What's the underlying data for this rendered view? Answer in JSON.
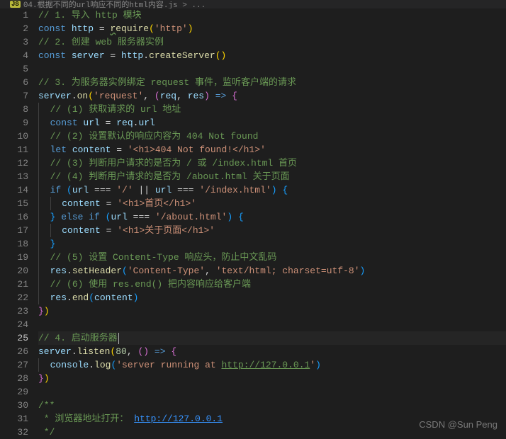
{
  "tab": {
    "badge": "JS",
    "title": "04.根据不同的url响应不同的html内容.js > ..."
  },
  "active_line": 25,
  "lines": [
    {
      "n": 1,
      "spans": [
        {
          "t": "// 1. 导入 http 模块",
          "c": "c-comment"
        }
      ]
    },
    {
      "n": 2,
      "spans": [
        {
          "t": "const ",
          "c": "c-keyword"
        },
        {
          "t": "http",
          "c": "c-var"
        },
        {
          "t": " = ",
          "c": "c-punct"
        },
        {
          "t": "r",
          "c": "c-func squiggle"
        },
        {
          "t": "equire",
          "c": "c-func"
        },
        {
          "t": "(",
          "c": "c-brace-y"
        },
        {
          "t": "'http'",
          "c": "c-string"
        },
        {
          "t": ")",
          "c": "c-brace-y"
        }
      ]
    },
    {
      "n": 3,
      "spans": [
        {
          "t": "// 2. 创建 web 服务器实例",
          "c": "c-comment"
        }
      ]
    },
    {
      "n": 4,
      "spans": [
        {
          "t": "const ",
          "c": "c-keyword"
        },
        {
          "t": "server",
          "c": "c-var"
        },
        {
          "t": " = ",
          "c": "c-punct"
        },
        {
          "t": "http",
          "c": "c-var"
        },
        {
          "t": ".",
          "c": "c-punct"
        },
        {
          "t": "createServer",
          "c": "c-func"
        },
        {
          "t": "(",
          "c": "c-brace-y"
        },
        {
          "t": ")",
          "c": "c-brace-y"
        }
      ]
    },
    {
      "n": 5,
      "spans": []
    },
    {
      "n": 6,
      "spans": [
        {
          "t": "// 3. 为服务器实例绑定 request 事件，监听客户端的请求",
          "c": "c-comment"
        }
      ]
    },
    {
      "n": 7,
      "spans": [
        {
          "t": "server",
          "c": "c-var"
        },
        {
          "t": ".",
          "c": "c-punct"
        },
        {
          "t": "on",
          "c": "c-func"
        },
        {
          "t": "(",
          "c": "c-brace-y"
        },
        {
          "t": "'request'",
          "c": "c-string"
        },
        {
          "t": ", ",
          "c": "c-punct"
        },
        {
          "t": "(",
          "c": "c-brace-p"
        },
        {
          "t": "req",
          "c": "c-var"
        },
        {
          "t": ", ",
          "c": "c-punct"
        },
        {
          "t": "res",
          "c": "c-var"
        },
        {
          "t": ")",
          "c": "c-brace-p"
        },
        {
          "t": " ",
          "c": "c-punct"
        },
        {
          "t": "=>",
          "c": "c-keyword"
        },
        {
          "t": " ",
          "c": "c-punct"
        },
        {
          "t": "{",
          "c": "c-brace-p"
        }
      ]
    },
    {
      "n": 8,
      "indent": 1,
      "spans": [
        {
          "t": "// (1) 获取请求的 url 地址",
          "c": "c-comment"
        }
      ]
    },
    {
      "n": 9,
      "indent": 1,
      "spans": [
        {
          "t": "const ",
          "c": "c-keyword"
        },
        {
          "t": "url",
          "c": "c-var"
        },
        {
          "t": " = ",
          "c": "c-punct"
        },
        {
          "t": "req",
          "c": "c-var"
        },
        {
          "t": ".",
          "c": "c-punct"
        },
        {
          "t": "url",
          "c": "c-var"
        }
      ]
    },
    {
      "n": 10,
      "indent": 1,
      "spans": [
        {
          "t": "// (2) 设置默认的响应内容为 404 Not found",
          "c": "c-comment"
        }
      ]
    },
    {
      "n": 11,
      "indent": 1,
      "spans": [
        {
          "t": "let ",
          "c": "c-keyword"
        },
        {
          "t": "content",
          "c": "c-var"
        },
        {
          "t": " = ",
          "c": "c-punct"
        },
        {
          "t": "'<h1>404 Not found!</h1>'",
          "c": "c-string"
        }
      ]
    },
    {
      "n": 12,
      "indent": 1,
      "spans": [
        {
          "t": "// (3) 判断用户请求的是否为 / 或 /index.html 首页",
          "c": "c-comment"
        }
      ]
    },
    {
      "n": 13,
      "indent": 1,
      "spans": [
        {
          "t": "// (4) 判断用户请求的是否为 /about.html 关于页面",
          "c": "c-comment"
        }
      ]
    },
    {
      "n": 14,
      "indent": 1,
      "spans": [
        {
          "t": "if ",
          "c": "c-keyword"
        },
        {
          "t": "(",
          "c": "c-brace-b"
        },
        {
          "t": "url",
          "c": "c-var"
        },
        {
          "t": " === ",
          "c": "c-punct"
        },
        {
          "t": "'/'",
          "c": "c-string"
        },
        {
          "t": " || ",
          "c": "c-punct"
        },
        {
          "t": "url",
          "c": "c-var"
        },
        {
          "t": " === ",
          "c": "c-punct"
        },
        {
          "t": "'/index.html'",
          "c": "c-string"
        },
        {
          "t": ")",
          "c": "c-brace-b"
        },
        {
          "t": " ",
          "c": "c-punct"
        },
        {
          "t": "{",
          "c": "c-brace-b"
        }
      ]
    },
    {
      "n": 15,
      "indent": 2,
      "spans": [
        {
          "t": "content",
          "c": "c-var"
        },
        {
          "t": " = ",
          "c": "c-punct"
        },
        {
          "t": "'<h1>首页</h1>'",
          "c": "c-string"
        }
      ]
    },
    {
      "n": 16,
      "indent": 1,
      "spans": [
        {
          "t": "}",
          "c": "c-brace-b"
        },
        {
          "t": " ",
          "c": "c-punct"
        },
        {
          "t": "else if ",
          "c": "c-keyword"
        },
        {
          "t": "(",
          "c": "c-brace-b"
        },
        {
          "t": "url",
          "c": "c-var"
        },
        {
          "t": " === ",
          "c": "c-punct"
        },
        {
          "t": "'/about.html'",
          "c": "c-string"
        },
        {
          "t": ")",
          "c": "c-brace-b"
        },
        {
          "t": " ",
          "c": "c-punct"
        },
        {
          "t": "{",
          "c": "c-brace-b"
        }
      ]
    },
    {
      "n": 17,
      "indent": 2,
      "spans": [
        {
          "t": "content",
          "c": "c-var"
        },
        {
          "t": " = ",
          "c": "c-punct"
        },
        {
          "t": "'<h1>关于页面</h1>'",
          "c": "c-string"
        }
      ]
    },
    {
      "n": 18,
      "indent": 1,
      "spans": [
        {
          "t": "}",
          "c": "c-brace-b"
        }
      ]
    },
    {
      "n": 19,
      "indent": 1,
      "spans": [
        {
          "t": "// (5) 设置 Content-Type 响应头，防止中文乱码",
          "c": "c-comment"
        }
      ]
    },
    {
      "n": 20,
      "indent": 1,
      "spans": [
        {
          "t": "res",
          "c": "c-var"
        },
        {
          "t": ".",
          "c": "c-punct"
        },
        {
          "t": "setHeader",
          "c": "c-func"
        },
        {
          "t": "(",
          "c": "c-brace-b"
        },
        {
          "t": "'Content-Type'",
          "c": "c-string"
        },
        {
          "t": ", ",
          "c": "c-punct"
        },
        {
          "t": "'text/html; charset=utf-8'",
          "c": "c-string"
        },
        {
          "t": ")",
          "c": "c-brace-b"
        }
      ]
    },
    {
      "n": 21,
      "indent": 1,
      "spans": [
        {
          "t": "// (6) 使用 res.end() 把内容响应给客户端",
          "c": "c-comment"
        }
      ]
    },
    {
      "n": 22,
      "indent": 1,
      "spans": [
        {
          "t": "res",
          "c": "c-var"
        },
        {
          "t": ".",
          "c": "c-punct"
        },
        {
          "t": "end",
          "c": "c-func"
        },
        {
          "t": "(",
          "c": "c-brace-b"
        },
        {
          "t": "content",
          "c": "c-var"
        },
        {
          "t": ")",
          "c": "c-brace-b"
        }
      ]
    },
    {
      "n": 23,
      "spans": [
        {
          "t": "}",
          "c": "c-brace-p"
        },
        {
          "t": ")",
          "c": "c-brace-y"
        }
      ]
    },
    {
      "n": 24,
      "spans": []
    },
    {
      "n": 25,
      "spans": [
        {
          "t": "// 4. 启动服务器",
          "c": "c-comment"
        }
      ],
      "cursor": true
    },
    {
      "n": 26,
      "spans": [
        {
          "t": "server",
          "c": "c-var"
        },
        {
          "t": ".",
          "c": "c-punct"
        },
        {
          "t": "listen",
          "c": "c-func"
        },
        {
          "t": "(",
          "c": "c-brace-y"
        },
        {
          "t": "80",
          "c": "c-number"
        },
        {
          "t": ", ",
          "c": "c-punct"
        },
        {
          "t": "(",
          "c": "c-brace-p"
        },
        {
          "t": ")",
          "c": "c-brace-p"
        },
        {
          "t": " ",
          "c": "c-punct"
        },
        {
          "t": "=>",
          "c": "c-keyword"
        },
        {
          "t": " ",
          "c": "c-punct"
        },
        {
          "t": "{",
          "c": "c-brace-p"
        }
      ]
    },
    {
      "n": 27,
      "indent": 1,
      "spans": [
        {
          "t": "console",
          "c": "c-var"
        },
        {
          "t": ".",
          "c": "c-punct"
        },
        {
          "t": "log",
          "c": "c-func"
        },
        {
          "t": "(",
          "c": "c-brace-b"
        },
        {
          "t": "'server running at ",
          "c": "c-string"
        },
        {
          "t": "http://127.0.0.1",
          "c": "c-string c-url"
        },
        {
          "t": "'",
          "c": "c-string"
        },
        {
          "t": ")",
          "c": "c-brace-b"
        }
      ]
    },
    {
      "n": 28,
      "spans": [
        {
          "t": "}",
          "c": "c-brace-p"
        },
        {
          "t": ")",
          "c": "c-brace-y"
        }
      ]
    },
    {
      "n": 29,
      "spans": []
    },
    {
      "n": 30,
      "spans": [
        {
          "t": "/**",
          "c": "c-comment"
        }
      ]
    },
    {
      "n": 31,
      "spans": [
        {
          "t": " * 浏览器地址打开： ",
          "c": "c-comment"
        },
        {
          "t": "http://127.0.0.1",
          "c": "c-url2"
        }
      ]
    },
    {
      "n": 32,
      "spans": [
        {
          "t": " */",
          "c": "c-comment"
        }
      ]
    }
  ],
  "watermark": "CSDN @Sun Peng"
}
